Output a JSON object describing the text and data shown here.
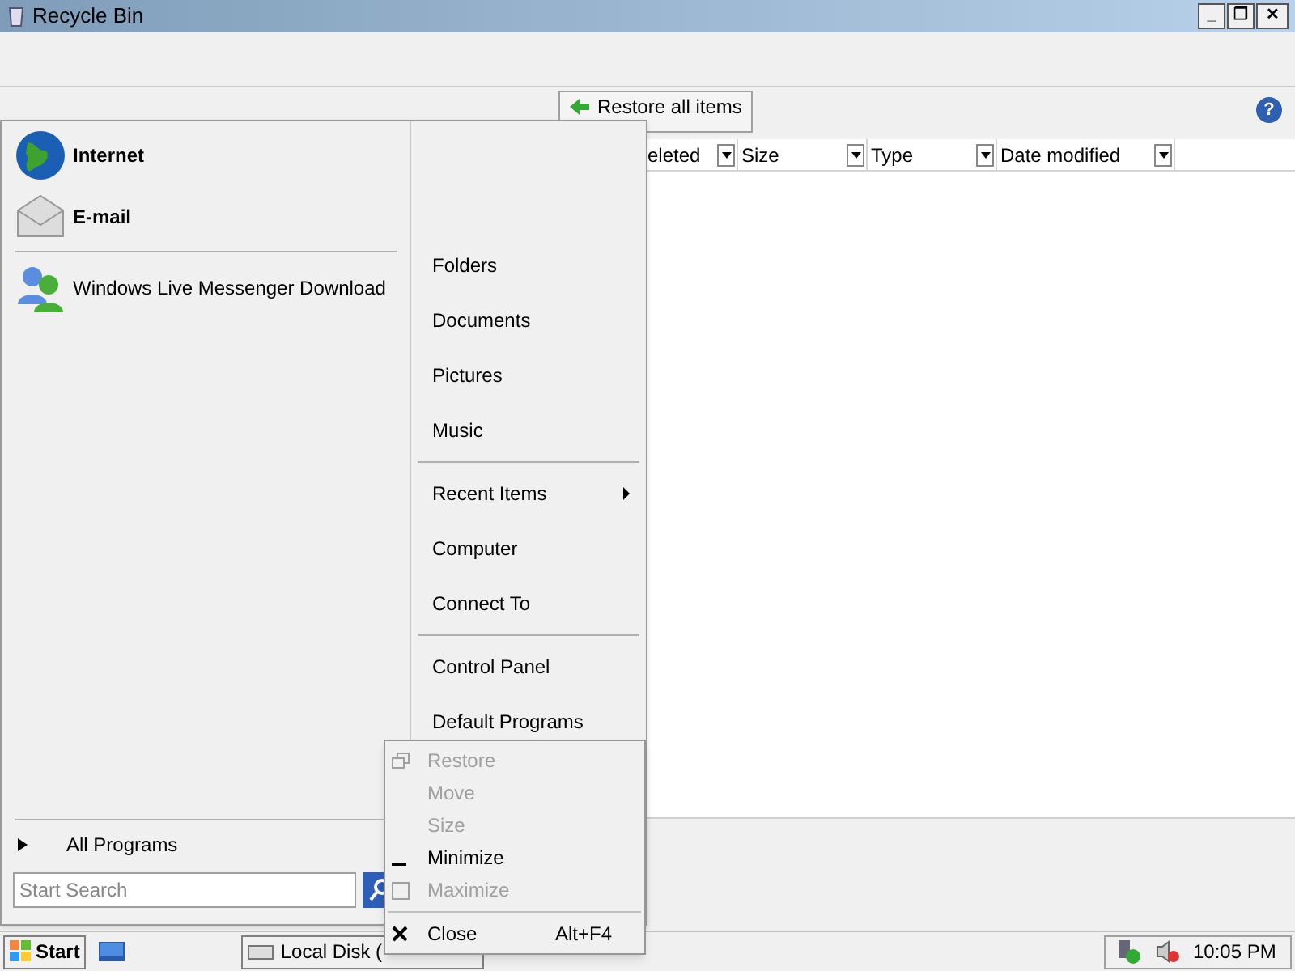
{
  "window": {
    "title": "Recycle Bin",
    "controls": [
      "_",
      "❐",
      "✕"
    ]
  },
  "toolbar": {
    "restore_button": "Restore all items",
    "help": "?"
  },
  "columns": [
    "eleted",
    "Size",
    "Type",
    "Date modified"
  ],
  "start_menu": {
    "pinned": [
      {
        "label": "Internet"
      },
      {
        "label": "E-mail"
      }
    ],
    "recent": [
      {
        "label": "Windows Live Messenger Download"
      }
    ],
    "all_programs": "All Programs",
    "search": {
      "placeholder": "Start Search"
    },
    "places": [
      [
        {
          "label": "Folders",
          "submenu": false
        },
        {
          "label": "Documents",
          "submenu": false
        },
        {
          "label": "Pictures",
          "submenu": false
        },
        {
          "label": "Music",
          "submenu": false
        }
      ],
      [
        {
          "label": "Recent Items",
          "submenu": true
        },
        {
          "label": "Computer",
          "submenu": false
        },
        {
          "label": "Connect To",
          "submenu": false
        }
      ],
      [
        {
          "label": "Control Panel",
          "submenu": false
        },
        {
          "label": "Default Programs",
          "submenu": false
        }
      ]
    ]
  },
  "context_menu": [
    {
      "label": "Restore",
      "disabled": true
    },
    {
      "label": "Move",
      "disabled": true
    },
    {
      "label": "Size",
      "disabled": true
    },
    {
      "label": "Minimize",
      "disabled": false
    },
    {
      "label": "Maximize",
      "disabled": true
    },
    {
      "label": "Close",
      "disabled": false,
      "shortcut": "Alt+F4",
      "separator_before": true
    }
  ],
  "taskbar": {
    "start": "Start",
    "task": "Local Disk (",
    "clock": "10:05 PM"
  }
}
